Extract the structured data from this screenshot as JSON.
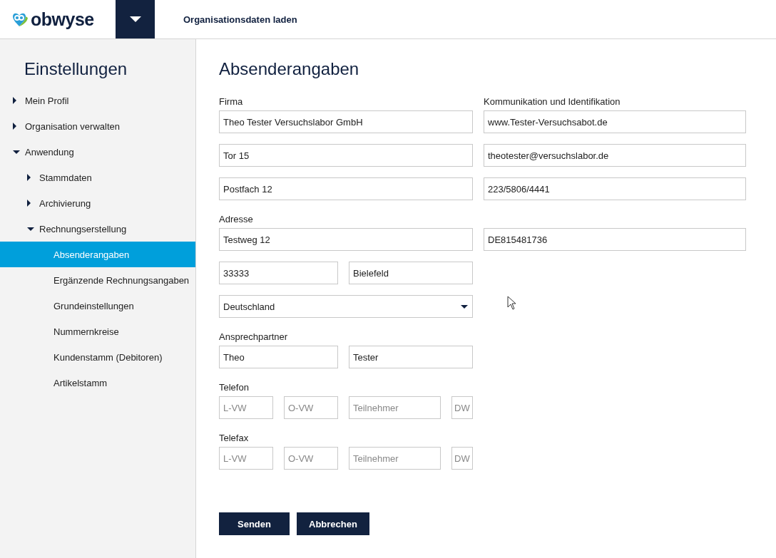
{
  "header": {
    "logo_text": "obwyse",
    "title": "Organisationsdaten laden"
  },
  "sidebar": {
    "title": "Einstellungen",
    "items": [
      {
        "label": "Mein Profil",
        "expanded": false,
        "selected": false
      },
      {
        "label": "Organisation verwalten",
        "expanded": false,
        "selected": false
      },
      {
        "label": "Anwendung",
        "expanded": true,
        "selected": false,
        "children": [
          {
            "label": "Stammdaten",
            "expanded": false,
            "selected": false
          },
          {
            "label": "Archivierung",
            "expanded": false,
            "selected": false
          },
          {
            "label": "Rechnungserstellung",
            "expanded": true,
            "selected": false,
            "children": [
              {
                "label": "Absenderangaben",
                "selected": true
              },
              {
                "label": "Ergänzende Rechnungsangaben",
                "selected": false
              },
              {
                "label": "Grundeinstellungen",
                "selected": false
              },
              {
                "label": "Nummernkreise",
                "selected": false
              },
              {
                "label": "Kundenstamm (Debitoren)",
                "selected": false
              },
              {
                "label": "Artikelstamm",
                "selected": false
              }
            ]
          }
        ]
      }
    ]
  },
  "form": {
    "title": "Absenderangaben",
    "rows": [
      {
        "kind": "label",
        "left": "Firma",
        "right": "Kommunikation und Identifikation"
      },
      {
        "kind": "fields",
        "left": [
          {
            "value": "Theo Tester Versuchslabor GmbH"
          }
        ],
        "right": [
          {
            "value": "www.Tester-Versuchsabot.de"
          }
        ]
      },
      {
        "kind": "fields",
        "left": [
          {
            "value": "Tor 15"
          }
        ],
        "right": [
          {
            "value": "theotester@versuchslabor.de"
          }
        ]
      },
      {
        "kind": "fields",
        "left": [
          {
            "value": "Postfach 12"
          }
        ],
        "right": [
          {
            "value": "223/5806/4441"
          }
        ]
      },
      {
        "kind": "label",
        "left": "Adresse"
      },
      {
        "kind": "fields",
        "left": [
          {
            "value": "Testweg 12"
          }
        ],
        "right": [
          {
            "value": "DE815481736"
          }
        ]
      },
      {
        "kind": "fields",
        "left": [
          {
            "value": "33333"
          },
          {
            "value": "Bielefeld"
          }
        ]
      },
      {
        "kind": "select",
        "left": [
          {
            "value": "Deutschland"
          }
        ]
      },
      {
        "kind": "label",
        "left": "Ansprechpartner"
      },
      {
        "kind": "fields",
        "left": [
          {
            "value": "Theo"
          },
          {
            "value": "Tester"
          }
        ]
      },
      {
        "kind": "label",
        "left": "Telefon"
      },
      {
        "kind": "phone",
        "left": [
          {
            "placeholder": "L-VW"
          },
          {
            "placeholder": "O-VW"
          },
          {
            "placeholder": "Teilnehmer"
          },
          {
            "placeholder": "DW"
          }
        ]
      },
      {
        "kind": "label",
        "left": "Telefax"
      },
      {
        "kind": "phone",
        "left": [
          {
            "placeholder": "L-VW"
          },
          {
            "placeholder": "O-VW"
          },
          {
            "placeholder": "Teilnehmer"
          },
          {
            "placeholder": "DW"
          }
        ]
      }
    ],
    "buttons": [
      "Senden",
      "Abbrechen"
    ]
  }
}
